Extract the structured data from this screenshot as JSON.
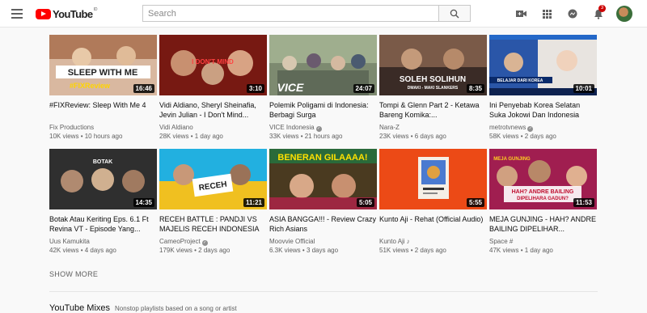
{
  "header": {
    "logo_text": "YouTube",
    "logo_cc": "ID",
    "search_placeholder": "Search",
    "notification_count": "3",
    "icons": [
      "menu-icon",
      "search-icon",
      "create-video-icon",
      "apps-icon",
      "messages-icon",
      "notifications-icon"
    ]
  },
  "colors": {
    "brand_red": "#ff0000",
    "badge_red": "#cc0000",
    "meta_gray": "#606060"
  },
  "videos": [
    [
      {
        "title": "#FIXReview: Sleep With Me 4",
        "channel": "Fix Productions",
        "verified": false,
        "note": false,
        "views": "10K views",
        "age": "10 hours ago",
        "duration": "16:46",
        "thumb_text": "SLEEP WITH ME\n#FIXReview"
      },
      {
        "title": "Vidi Aldiano, Sheryl Sheinafia, Jevin Julian - I Don't Mind...",
        "channel": "Vidi Aldiano",
        "verified": false,
        "note": false,
        "views": "28K views",
        "age": "1 day ago",
        "duration": "3:10",
        "thumb_text": "I DON'T MIND"
      },
      {
        "title": "Polemik Poligami di Indonesia: Berbagi Surga",
        "channel": "VICE Indonesia",
        "verified": true,
        "note": false,
        "views": "33K views",
        "age": "21 hours ago",
        "duration": "24:07",
        "thumb_text": "VICE"
      },
      {
        "title": "Tompi & Glenn Part 2 - Ketawa Bareng Komika:...",
        "channel": "Nara-Z",
        "verified": false,
        "note": false,
        "views": "23K views",
        "age": "6 days ago",
        "duration": "8:35",
        "thumb_text": "SOLEH SOLIHUN\nDMAKI - MAKI SLANKERS"
      },
      {
        "title": "Ini Penyebab Korea Selatan Suka Jokowi Dan Indonesia",
        "channel": "metrotvnews",
        "verified": true,
        "note": false,
        "views": "58K views",
        "age": "2 days ago",
        "duration": "10:01",
        "thumb_text": "BELAJAR DARI KOREA"
      }
    ],
    [
      {
        "title": "Botak Atau Keriting Eps. 6.1 Ft Revina VT - Episode Yang...",
        "channel": "Uus Kamukita",
        "verified": false,
        "note": false,
        "views": "42K views",
        "age": "4 days ago",
        "duration": "14:35",
        "thumb_text": "BOTAK"
      },
      {
        "title": "RECEH BATTLE : PANDJI VS MAJELIS RECEH INDONESIA",
        "channel": "CameoProject",
        "verified": true,
        "note": false,
        "views": "179K views",
        "age": "2 days ago",
        "duration": "11:21",
        "thumb_text": "RECEH BATTLE"
      },
      {
        "title": "ASIA BANGGA!!! - Review Crazy Rich Asians",
        "channel": "Moovvie Official",
        "verified": false,
        "note": false,
        "views": "6.3K views",
        "age": "3 days ago",
        "duration": "5:05",
        "thumb_text": "BENERAN GILAAAA!"
      },
      {
        "title": "Kunto Aji - Rehat (Official Audio)",
        "channel": "Kunto Aji",
        "verified": false,
        "note": true,
        "views": "51K views",
        "age": "2 days ago",
        "duration": "5:55",
        "thumb_text": ""
      },
      {
        "title": "MEJA GUNJING - HAH? ANDRE BAILING DIPELIHAR...",
        "channel": "Space #",
        "verified": false,
        "note": false,
        "views": "47K views",
        "age": "1 day ago",
        "duration": "11:53",
        "thumb_text": "HAH? ANDRE BAILING\nDIPELIHARA GADUN?"
      }
    ]
  ],
  "show_more": "SHOW MORE",
  "mixes": {
    "title": "YouTube Mixes",
    "subtitle": "Nonstop playlists based on a song or artist"
  }
}
